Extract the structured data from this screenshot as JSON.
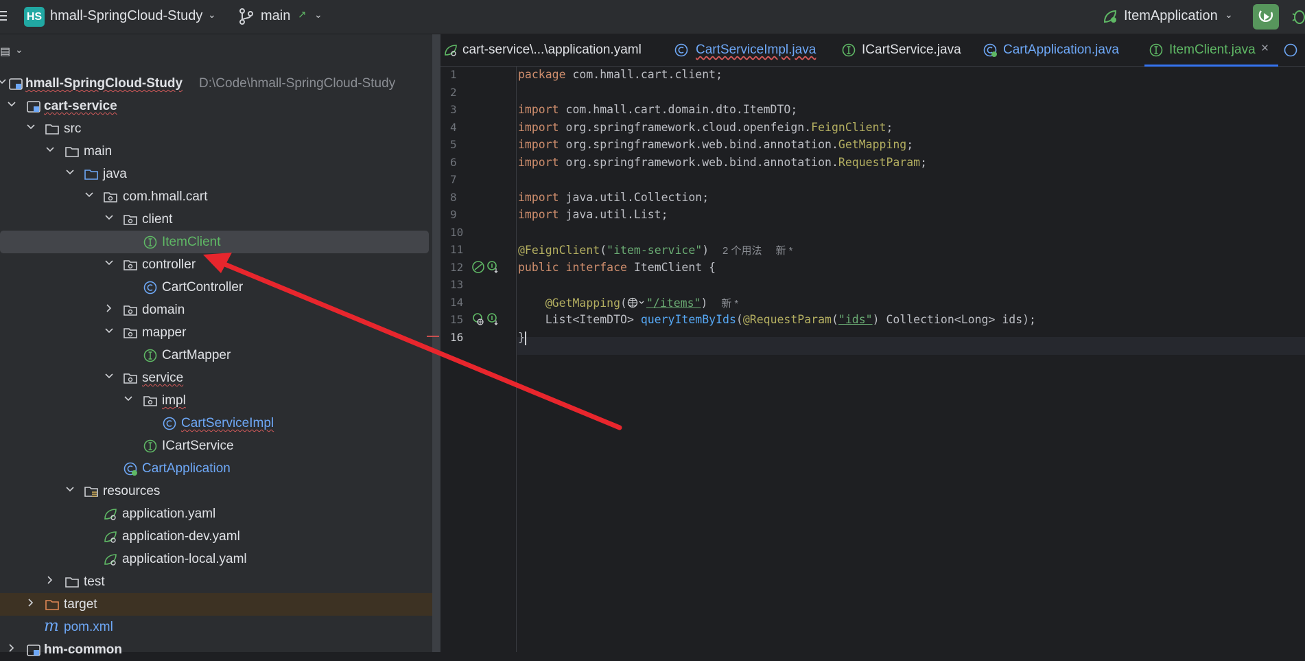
{
  "titlebar": {
    "project_badge": "HS",
    "project_name": "hmall-SpringCloud-Study",
    "branch": "main",
    "run_config": "ItemApplication"
  },
  "project_panel": {
    "tree": [
      {
        "label": "hmall-SpringCloud-Study",
        "path": "D:\\Code\\hmall-SpringCloud-Study",
        "icon": "module-icon"
      },
      {
        "label": "cart-service",
        "icon": "module-icon"
      },
      {
        "label": "src",
        "icon": "folder-icon"
      },
      {
        "label": "main",
        "icon": "folder-icon"
      },
      {
        "label": "java",
        "icon": "source-folder-icon"
      },
      {
        "label": "com.hmall.cart",
        "icon": "package-icon"
      },
      {
        "label": "client",
        "icon": "package-icon"
      },
      {
        "label": "ItemClient",
        "icon": "interface-icon"
      },
      {
        "label": "controller",
        "icon": "package-icon"
      },
      {
        "label": "CartController",
        "icon": "class-icon"
      },
      {
        "label": "domain",
        "icon": "package-icon"
      },
      {
        "label": "mapper",
        "icon": "package-icon"
      },
      {
        "label": "CartMapper",
        "icon": "interface-icon"
      },
      {
        "label": "service",
        "icon": "package-icon"
      },
      {
        "label": "impl",
        "icon": "package-icon"
      },
      {
        "label": "CartServiceImpl",
        "icon": "class-icon"
      },
      {
        "label": "ICartService",
        "icon": "interface-icon"
      },
      {
        "label": "CartApplication",
        "icon": "spring-boot-class-icon"
      },
      {
        "label": "resources",
        "icon": "resources-folder-icon"
      },
      {
        "label": "application.yaml",
        "icon": "spring-yaml-icon"
      },
      {
        "label": "application-dev.yaml",
        "icon": "spring-yaml-icon"
      },
      {
        "label": "application-local.yaml",
        "icon": "spring-yaml-icon"
      },
      {
        "label": "test",
        "icon": "folder-icon"
      },
      {
        "label": "target",
        "icon": "excluded-folder-icon"
      },
      {
        "label": "pom.xml",
        "icon": "maven-icon"
      },
      {
        "label": "hm-common",
        "icon": "module-icon"
      }
    ]
  },
  "editor": {
    "tabs": [
      {
        "label": "cart-service\\...\\application.yaml",
        "icon": "spring-yaml-icon"
      },
      {
        "label": "CartServiceImpl.java",
        "icon": "class-icon"
      },
      {
        "label": "ICartService.java",
        "icon": "interface-icon"
      },
      {
        "label": "CartApplication.java",
        "icon": "spring-boot-class-icon"
      },
      {
        "label": "ItemClient.java",
        "icon": "interface-icon",
        "active": true
      }
    ],
    "line_numbers": [
      "1",
      "2",
      "3",
      "4",
      "5",
      "6",
      "7",
      "8",
      "9",
      "10",
      "11",
      "12",
      "13",
      "14",
      "15",
      "16"
    ],
    "code": {
      "l1_kw": "package",
      "l1_rest": " com.hmall.cart.client;",
      "l3_kw": "import",
      "l3_rest": " com.hmall.cart.domain.dto.ItemDTO;",
      "l4_kw": "import",
      "l4_rest": " org.springframework.cloud.openfeign.",
      "l4_ann": "FeignClient",
      "l4_end": ";",
      "l5_kw": "import",
      "l5_rest": " org.springframework.web.bind.annotation.",
      "l5_ann": "GetMapping",
      "l5_end": ";",
      "l6_kw": "import",
      "l6_rest": " org.springframework.web.bind.annotation.",
      "l6_ann": "RequestParam",
      "l6_end": ";",
      "l8_kw": "import",
      "l8_rest": " java.util.Collection;",
      "l9_kw": "import",
      "l9_rest": " java.util.List;",
      "l11_ann": "@FeignClient",
      "l11_open": "(",
      "l11_str": "\"item-service\"",
      "l11_close": ")",
      "l11_hint_usages": "2 个用法",
      "l11_hint_new": "新 *",
      "l12_kw": "public interface",
      "l12_rest": " ItemClient {",
      "l14_ann": "@GetMapping",
      "l14_open": "(",
      "l14_str": "\"/items\"",
      "l14_close": ")",
      "l14_hint_new": "新 *",
      "l15_pre": "    List<ItemDTO> ",
      "l15_fn": "queryItemByIds",
      "l15_open": "(",
      "l15_ann": "@RequestParam",
      "l15_p1": "(",
      "l15_str": "\"ids\"",
      "l15_rest": ") Collection<Long> ids);",
      "l16": "}"
    }
  },
  "colors": {
    "accent": "#3574f0",
    "annotation_arrow": "#e8262d",
    "run_button": "#57965c"
  }
}
